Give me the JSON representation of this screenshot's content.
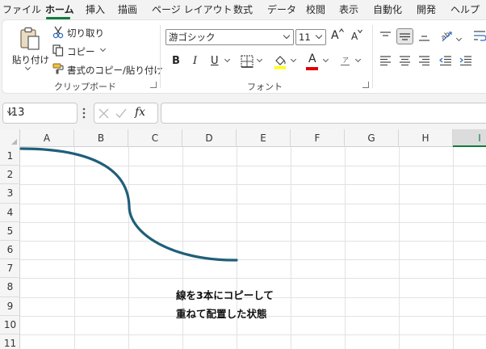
{
  "menu": {
    "tabs": [
      {
        "label": "ファイル",
        "active": false
      },
      {
        "label": "ホーム",
        "active": true
      },
      {
        "label": "挿入",
        "active": false
      },
      {
        "label": "描画",
        "active": false
      },
      {
        "label": "ページ レイアウト",
        "active": false
      },
      {
        "label": "数式",
        "active": false
      },
      {
        "label": "データ",
        "active": false
      },
      {
        "label": "校閲",
        "active": false
      },
      {
        "label": "表示",
        "active": false
      },
      {
        "label": "自動化",
        "active": false
      },
      {
        "label": "開発",
        "active": false
      },
      {
        "label": "ヘルプ",
        "active": false
      }
    ]
  },
  "ribbon": {
    "clipboard": {
      "paste_label": "貼り付け",
      "cut_label": "切り取り",
      "copy_label": "コピー",
      "format_painter_label": "書式のコピー/貼り付け",
      "group_label": "クリップボード"
    },
    "font": {
      "font_name": "游ゴシック",
      "font_size": "11",
      "grow_label": "A",
      "shrink_label": "A",
      "bold_label": "B",
      "italic_label": "I",
      "underline_label": "U",
      "font_color_label": "A",
      "phonetic_label": "ア",
      "group_label": "フォント",
      "fill_color": "#ffff00",
      "font_color": "#e00000"
    }
  },
  "formula_bar": {
    "name_box": "I13",
    "fx_label": "fx",
    "formula": ""
  },
  "sheet": {
    "columns": [
      "A",
      "B",
      "C",
      "D",
      "E",
      "F",
      "G",
      "H",
      "I"
    ],
    "selected_column": "I",
    "rows": [
      "1",
      "2",
      "3",
      "4",
      "5",
      "6",
      "7",
      "8",
      "9",
      "10",
      "11"
    ],
    "note_lines": [
      "線を3本にコピーして",
      "重ねて配置した状態"
    ],
    "curve_color": "#1f5f7a"
  },
  "colors": {
    "accent": "#117c3e",
    "ribbon_bg": "#f3f3f3"
  }
}
